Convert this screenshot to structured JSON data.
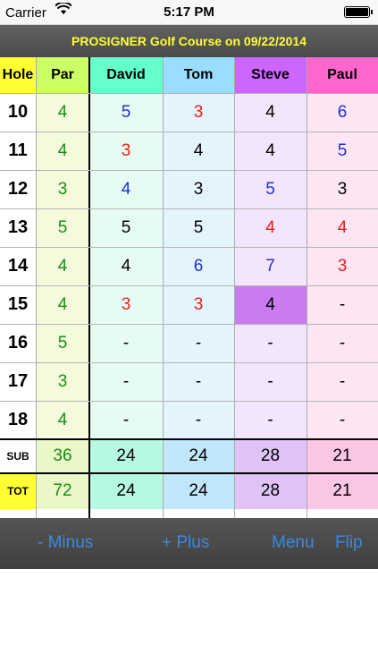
{
  "status": {
    "carrier": "Carrier",
    "time": "5:17 PM"
  },
  "title": "PROSIGNER Golf Course on 09/22/2014",
  "headers": [
    "Hole",
    "Par",
    "David",
    "Tom",
    "Steve",
    "Paul"
  ],
  "rows": [
    {
      "hole": "10",
      "par": "4",
      "scores": [
        "5",
        "3",
        "4",
        "6"
      ],
      "colors": [
        "#1f2fd6",
        "#e3201b",
        "#000000",
        "#1f2fd6"
      ]
    },
    {
      "hole": "11",
      "par": "4",
      "scores": [
        "3",
        "4",
        "4",
        "5"
      ],
      "colors": [
        "#e3201b",
        "#000000",
        "#000000",
        "#1f2fd6"
      ]
    },
    {
      "hole": "12",
      "par": "3",
      "scores": [
        "4",
        "3",
        "5",
        "3"
      ],
      "colors": [
        "#1f2fd6",
        "#000000",
        "#1f2fd6",
        "#000000"
      ]
    },
    {
      "hole": "13",
      "par": "5",
      "scores": [
        "5",
        "5",
        "4",
        "4"
      ],
      "colors": [
        "#000000",
        "#000000",
        "#e3201b",
        "#e3201b"
      ]
    },
    {
      "hole": "14",
      "par": "4",
      "scores": [
        "4",
        "6",
        "7",
        "3"
      ],
      "colors": [
        "#000000",
        "#1f2fd6",
        "#1f2fd6",
        "#e3201b"
      ]
    },
    {
      "hole": "15",
      "par": "4",
      "scores": [
        "3",
        "3",
        "4",
        "-"
      ],
      "colors": [
        "#e3201b",
        "#e3201b",
        "#000000",
        "#000000"
      ]
    },
    {
      "hole": "16",
      "par": "5",
      "scores": [
        "-",
        "-",
        "-",
        "-"
      ],
      "colors": [
        "#000000",
        "#000000",
        "#000000",
        "#000000"
      ]
    },
    {
      "hole": "17",
      "par": "3",
      "scores": [
        "-",
        "-",
        "-",
        "-"
      ],
      "colors": [
        "#000000",
        "#000000",
        "#000000",
        "#000000"
      ]
    },
    {
      "hole": "18",
      "par": "4",
      "scores": [
        "-",
        "-",
        "-",
        "-"
      ],
      "colors": [
        "#000000",
        "#000000",
        "#000000",
        "#000000"
      ]
    }
  ],
  "subtotal": {
    "label": "SUB",
    "par": "36",
    "scores": [
      "24",
      "24",
      "28",
      "21"
    ]
  },
  "total": {
    "label": "TOT",
    "par": "72",
    "scores": [
      "24",
      "24",
      "28",
      "21"
    ]
  },
  "toolbar": {
    "minus": "- Minus",
    "plus": "+ Plus",
    "menu": "Menu",
    "flip": "Flip"
  },
  "colors": {
    "title_text": "#ffff33",
    "hole_header": "#ffff33",
    "par_header": "#ccff66",
    "david_header": "#66ffcc",
    "tom_header": "#99ddff",
    "steve_header": "#cc66ff",
    "paul_header": "#ff66cc",
    "selected_cell": "#c97cf0",
    "par_text": "#1a8a1a",
    "over_par": "#1f2fd6",
    "under_par": "#e3201b",
    "toolbar_text": "#3a8be0"
  }
}
